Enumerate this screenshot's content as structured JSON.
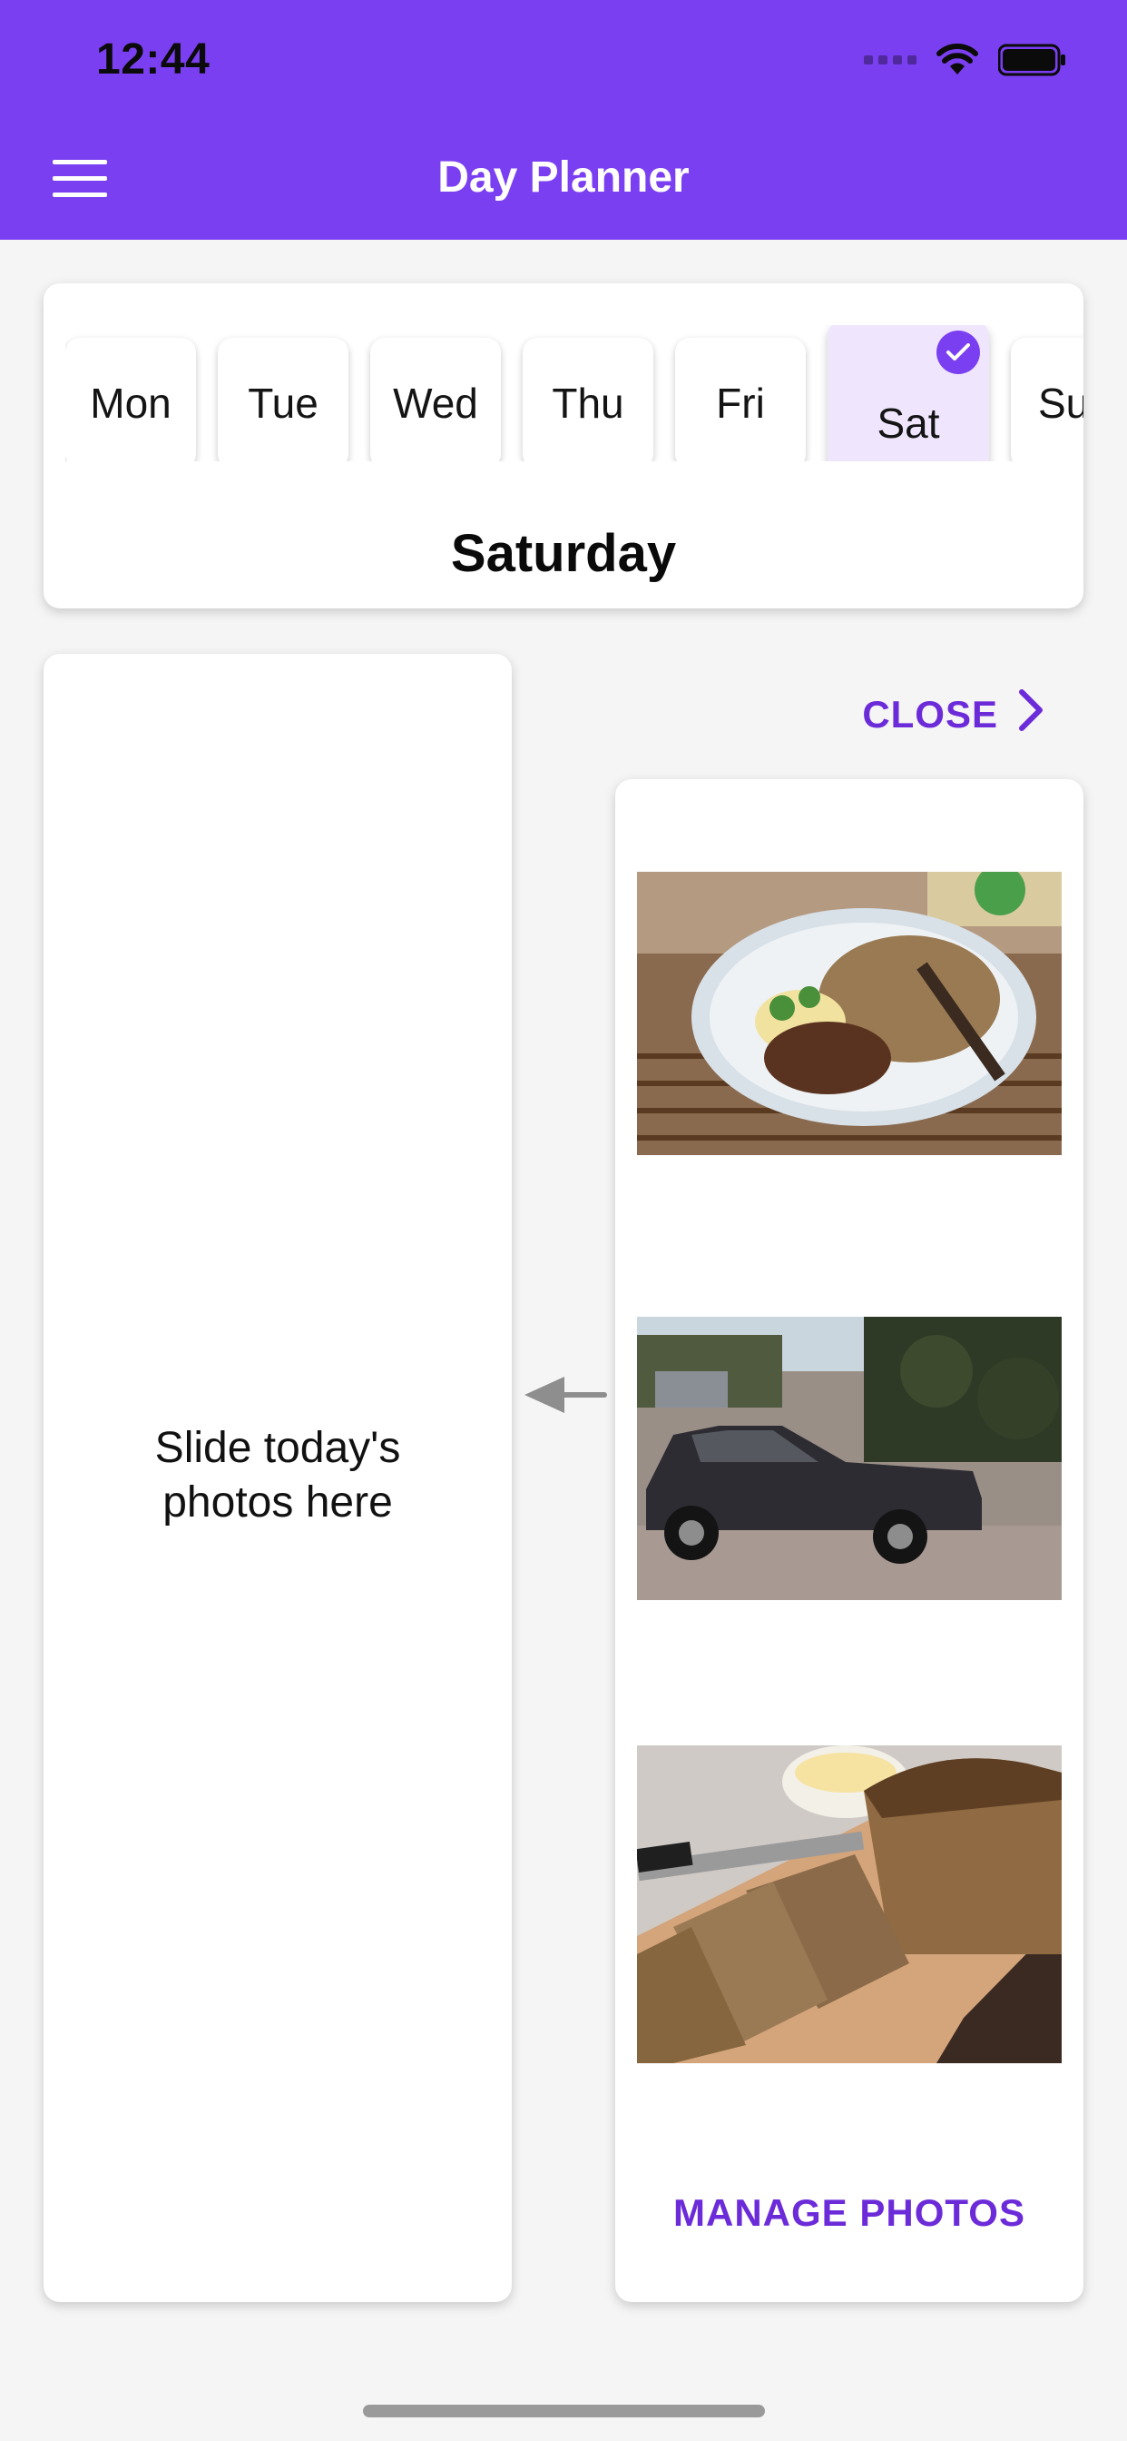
{
  "status_bar": {
    "time": "12:44"
  },
  "app_bar": {
    "title": "Day Planner",
    "background": "#7b3ff2",
    "menu_icon": "hamburger-menu-icon"
  },
  "day_selector": {
    "days": [
      "Mon",
      "Tue",
      "Wed",
      "Thu",
      "Fri",
      "Sat",
      "Su"
    ],
    "selected_index": 5,
    "selected_badge_icon": "check-icon",
    "selected_day_title": "Saturday",
    "accent": "#7b3ff2",
    "selected_chip_bg": "#efe6fd"
  },
  "drop_zone": {
    "hint": "Slide today's\nphotos here",
    "arrow_icon": "arrow-left-icon"
  },
  "photo_panel": {
    "close_label": "CLOSE",
    "close_icon": "chevron-right-icon",
    "photos": [
      {
        "name": "plate-of-food-photo"
      },
      {
        "name": "old-car-photo"
      },
      {
        "name": "bread-loaf-photo"
      }
    ],
    "manage_label": "MANAGE PHOTOS",
    "link_color": "#6c2bd9"
  }
}
